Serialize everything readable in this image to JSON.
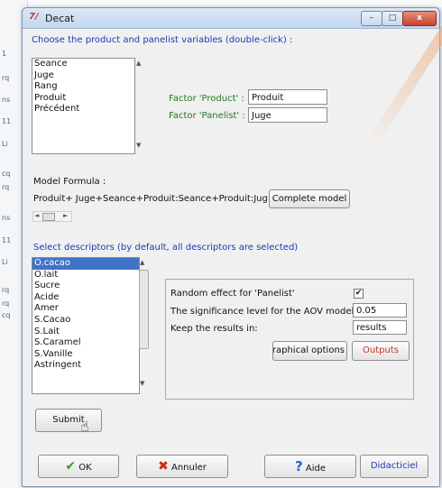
{
  "window": {
    "title": "Decat",
    "icon": "tk-feather-icon",
    "icon_text": "7/"
  },
  "desktop_strip_labels": [
    "1",
    "rq",
    "ns",
    "11",
    "Li",
    "cq",
    "rq",
    "ns",
    "11",
    "Li",
    "rq",
    "rq",
    "cq"
  ],
  "product_panelist": {
    "heading": "Choose the product and panelist variables (double-click) :",
    "variables": [
      "Seance",
      "Juge",
      "Rang",
      "Produit",
      "Précédent"
    ],
    "factor_product_label": "Factor 'Product' :",
    "factor_product_value": "Produit",
    "factor_panelist_label": "Factor 'Panelist' :",
    "factor_panelist_value": "Juge"
  },
  "model": {
    "label": "Model Formula :",
    "formula": "Produit+ Juge+Seance+Produit:Seance+Produit:Juge+",
    "complete_button": "Complete model"
  },
  "descriptors": {
    "heading": "Select descriptors (by default, all descriptors are selected)",
    "items": [
      "O.cacao",
      "O.lait",
      "Sucre",
      "Acide",
      "Amer",
      "S.Cacao",
      "S.Lait",
      "S.Caramel",
      "S.Vanille",
      "Astringent"
    ],
    "selected": "O.cacao"
  },
  "options": {
    "random_effect_label": "Random effect for 'Panelist'",
    "random_effect_checked": true,
    "significance_label": "The significance level for the AOV model:",
    "significance_value": "0.05",
    "keep_label": "Keep the results in:",
    "keep_value": "results",
    "graphical_button": "Graphical options",
    "outputs_button": "Outputs"
  },
  "submit_button": "Submit",
  "footer": {
    "ok": "OK",
    "cancel": "Annuler",
    "help": "Aide",
    "tutorial": "Didacticiel"
  },
  "colors": {
    "label_blue": "#1f38b5",
    "label_green": "#1f7a1f",
    "selection": "#3f74c9",
    "outputs_text": "#c0392b"
  }
}
